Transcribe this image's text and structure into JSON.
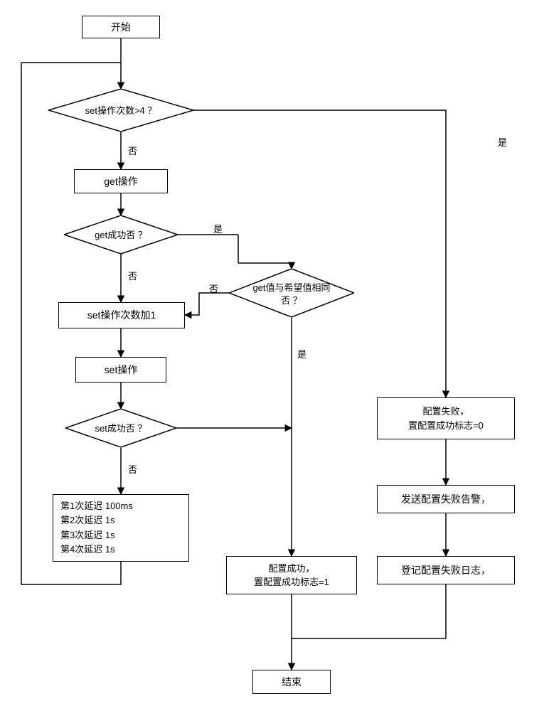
{
  "nodes": {
    "start": "开始",
    "get_op": "get操作",
    "set_count_inc": "set操作次数加1",
    "set_op": "set操作",
    "config_ok": "配置成功，\n置配置成功标志=1",
    "config_fail": "配置失败，\n置配置成功标志=0",
    "send_alarm": "发送配置失败告警，",
    "log_fail": "登记配置失败日志，",
    "end": "结束"
  },
  "decisions": {
    "set_gt4": "set操作次数>4 ？",
    "get_ok": "get成功否 ？",
    "get_eq": "get值与希望值相同\n否 ？",
    "set_ok": "set成功否 ？"
  },
  "labels": {
    "yes": "是",
    "no": "否"
  },
  "delays": {
    "line1": "第1次延迟  100ms",
    "line2": "第2次延迟  1s",
    "line3": "第3次延迟  1s",
    "line4": "第4次延迟  1s"
  }
}
